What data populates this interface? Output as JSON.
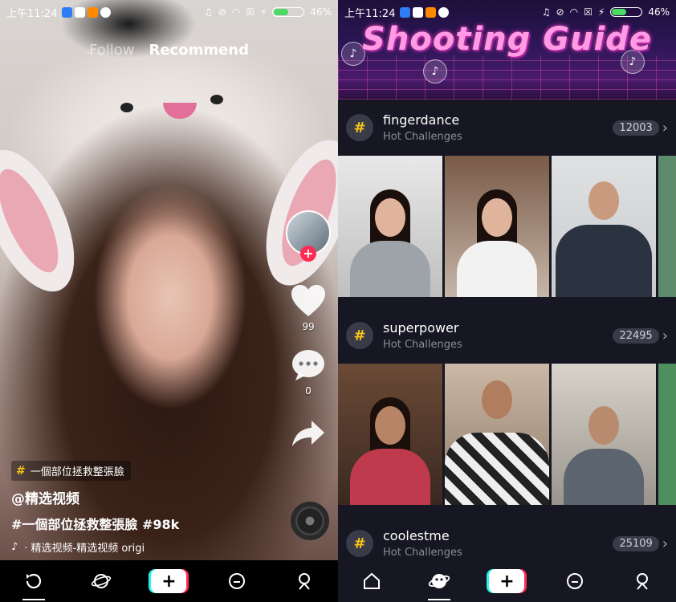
{
  "left": {
    "status": {
      "time": "上午11:24",
      "battery": "46%",
      "battery_level": 0.46
    },
    "nav": {
      "following": "Follow",
      "for_you": "Recommend"
    },
    "side": {
      "likes": "99",
      "comments": "0"
    },
    "caption": {
      "tag": "一個部位拯救整張臉",
      "username": "@精选视频",
      "description": "#一個部位拯救整張臉 #98k",
      "music": "· 精选视频-精选视频   origi"
    },
    "tabs": [
      "home-icon",
      "discover-icon",
      "create-icon",
      "messages-icon",
      "profile-icon"
    ]
  },
  "right": {
    "status": {
      "time": "上午11:24",
      "battery": "46%",
      "battery_level": 0.46
    },
    "banner_title": "Shooting Guide",
    "challenges": [
      {
        "name": "fingerdance",
        "subtitle": "Hot Challenges",
        "count": "12003"
      },
      {
        "name": "superpower",
        "subtitle": "Hot Challenges",
        "count": "22495"
      },
      {
        "name": "coolestme",
        "subtitle": "Hot Challenges",
        "count": "25109"
      }
    ],
    "colors": {
      "accent_pink": "#fe2c55",
      "accent_cyan": "#25f4ee",
      "hashtag": "#f5c518"
    }
  }
}
